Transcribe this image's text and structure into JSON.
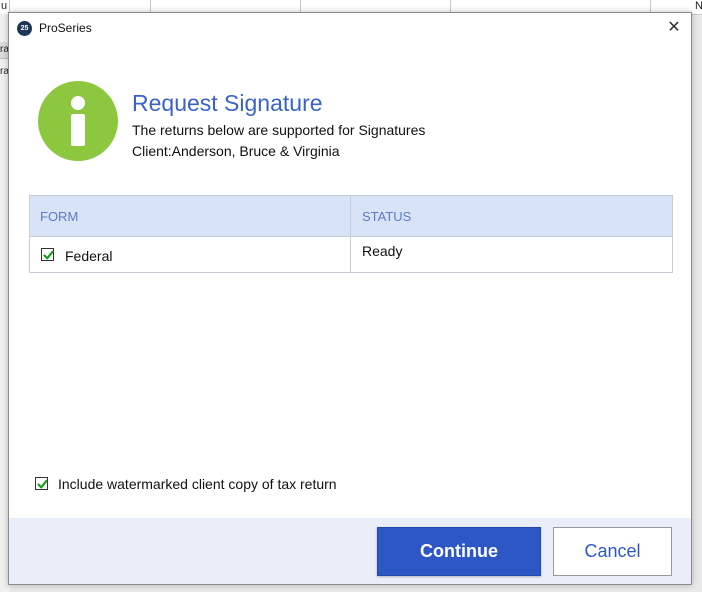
{
  "background": {
    "fragments": [
      "u",
      "N",
      "ra",
      "ra"
    ]
  },
  "window": {
    "app_icon_text": "25",
    "title": "ProSeries",
    "close_glyph": "✕"
  },
  "header": {
    "icon": "info-icon",
    "title": "Request Signature",
    "subtitle": "The returns below are supported for Signatures",
    "client_line": "Client:Anderson, Bruce & Virginia"
  },
  "table": {
    "columns": [
      "FORM",
      "STATUS"
    ],
    "rows": [
      {
        "form": "Federal",
        "status": "Ready",
        "checked": true
      }
    ]
  },
  "options": {
    "watermark_label": "Include watermarked client copy of tax return",
    "watermark_checked": true
  },
  "buttons": {
    "continue": "Continue",
    "cancel": "Cancel"
  },
  "colors": {
    "accent": "#3b63c6",
    "primary_button": "#2e57c6",
    "info_icon": "#8dc63f",
    "table_header": "#d9e3f8",
    "checkmark": "#1a9e1a"
  }
}
